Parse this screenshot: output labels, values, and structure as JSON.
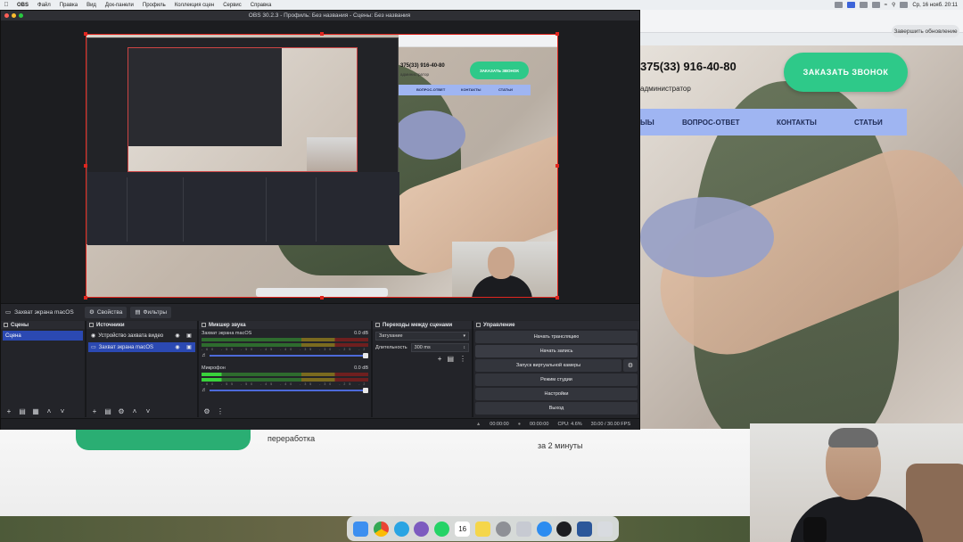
{
  "menubar": {
    "apple": "",
    "items": [
      "OBS",
      "Файл",
      "Правка",
      "Вид",
      "Док-панели",
      "Профиль",
      "Коллекция сцен",
      "Сервис",
      "Справка"
    ],
    "clock": "Ср, 16 нояб. 20:11"
  },
  "obs": {
    "window_title": "OBS 30.2.3 - Профиль: Без названия - Сцены: Без названия",
    "source_bar": {
      "source_name": "Захват экрана macOS",
      "properties_label": "Свойства",
      "filters_label": "Фильтры"
    },
    "scenes": {
      "title": "Сцены",
      "items": [
        "Сцена"
      ]
    },
    "sources": {
      "title": "Источники",
      "items": [
        {
          "label": "Устройство захвата видео",
          "selected": false
        },
        {
          "label": "Захват экрана macOS",
          "selected": true
        }
      ]
    },
    "mixer": {
      "title": "Микшер звука",
      "channels": [
        {
          "name": "Захват экрана macOS",
          "db": "0.0 dB"
        },
        {
          "name": "Микрофон",
          "db": "0.0 dB"
        }
      ],
      "ticks": "-60 -55 -50 -45 -40 -35 -30 -25 -20 -15 -10 -5 0"
    },
    "transitions": {
      "title": "Переходы между сценами",
      "type": "Затухание",
      "duration_label": "Длительность",
      "duration_value": "300 ms"
    },
    "controls": {
      "title": "Управление",
      "start_stream": "Начать трансляцию",
      "start_record": "Начать запись",
      "virtual_cam": "Запуск виртуальной камеры",
      "studio_mode": "Режим студии",
      "settings": "Настройки",
      "exit": "Выход"
    },
    "status": {
      "stream_time": "00:00:00",
      "rec_time": "00:00:00",
      "cpu": "CPU: 4.6%",
      "fps": "30.00 / 30.00 FPS"
    },
    "preview": {
      "phone": "375(33) 916-40-80",
      "admin": "администратор",
      "call_btn": "ЗАКАЗАТЬ ЗВОНОК",
      "nav": [
        "ВОПРОС-ОТВЕТ",
        "КОНТАКТЫ",
        "СТАТЬИ"
      ]
    }
  },
  "site": {
    "update_btn": "Завершить обновление",
    "phone": "375(33) 916-40-80",
    "admin": "администратор",
    "call_btn": "ЗАКАЗАТЬ ЗВОНОК",
    "nav": {
      "partial": "ЫЫ",
      "faq": "ВОПРОС-ОТВЕТ",
      "contacts": "КОНТАКТЫ",
      "articles": "СТАТЬИ"
    },
    "bottom_text_left": "переработка",
    "bottom_text_right": "за 2 минуты"
  },
  "dock": {
    "icons": [
      "finder-icon",
      "chrome-icon",
      "telegram-icon",
      "viber-icon",
      "whatsapp-icon",
      "calendar-icon",
      "notes-icon",
      "settings-icon",
      "launchpad-icon",
      "safari-icon",
      "obs-icon",
      "word-icon",
      "trash-icon"
    ],
    "calendar_day": "16"
  }
}
